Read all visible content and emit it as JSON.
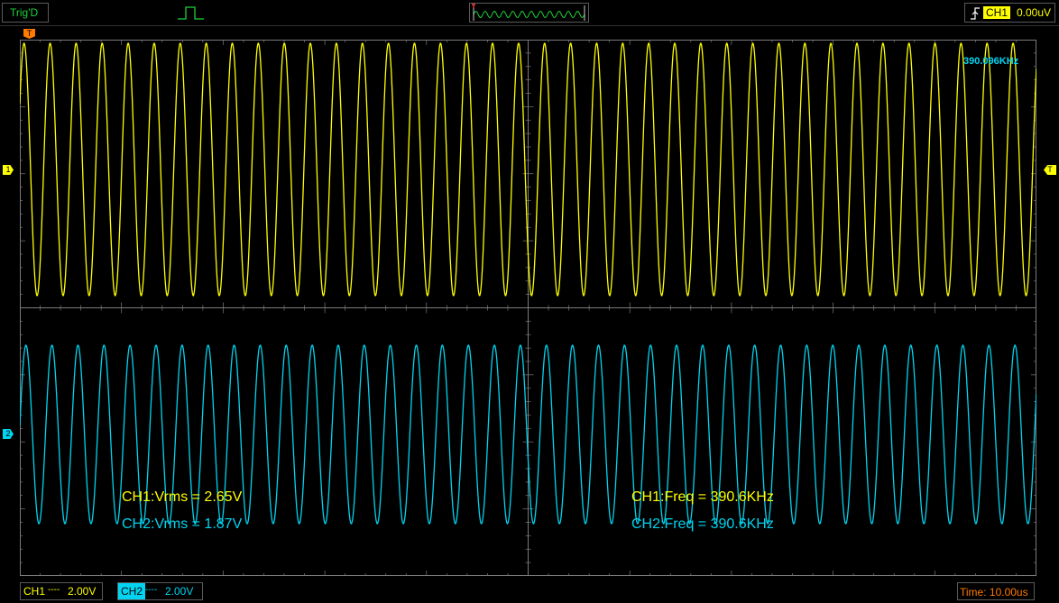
{
  "top_bar": {
    "trigger_status": "Trig'D",
    "trigger_source": "CH1",
    "trigger_level": "0.00uV",
    "icons": [
      "pulse-icon",
      "waveform-overview-icon",
      "rising-edge-icon"
    ]
  },
  "markers": {
    "ch1": "1",
    "ch2": "2",
    "trigger_level": "T",
    "trigger_position": "T"
  },
  "waveforms": {
    "ch1": {
      "color": "#ffff00",
      "frequency_khz": 390.6,
      "vrms": 2.65
    },
    "ch2": {
      "color": "#00d4f0",
      "frequency_khz": 390.6,
      "vrms": 1.87
    }
  },
  "freq_readout": "390.096KHz",
  "measurements": [
    "CH1:Vrms = 2.65V",
    "CH2:Vrms = 1.87V",
    "CH1:Freq = 390.6KHz",
    "CH2:Freq = 390.6KHz"
  ],
  "bottom_bar": {
    "ch1_label": "CH1",
    "ch1_coupling": "----",
    "ch1_scale": "2.00V",
    "ch2_label": "CH2",
    "ch2_coupling": "----",
    "ch2_scale": "2.00V",
    "timebase": "Time: 10.00us"
  },
  "colors": {
    "grid": "#7a7a7a",
    "trigger": "#ff7a00",
    "status_ok": "#1fd13a"
  }
}
